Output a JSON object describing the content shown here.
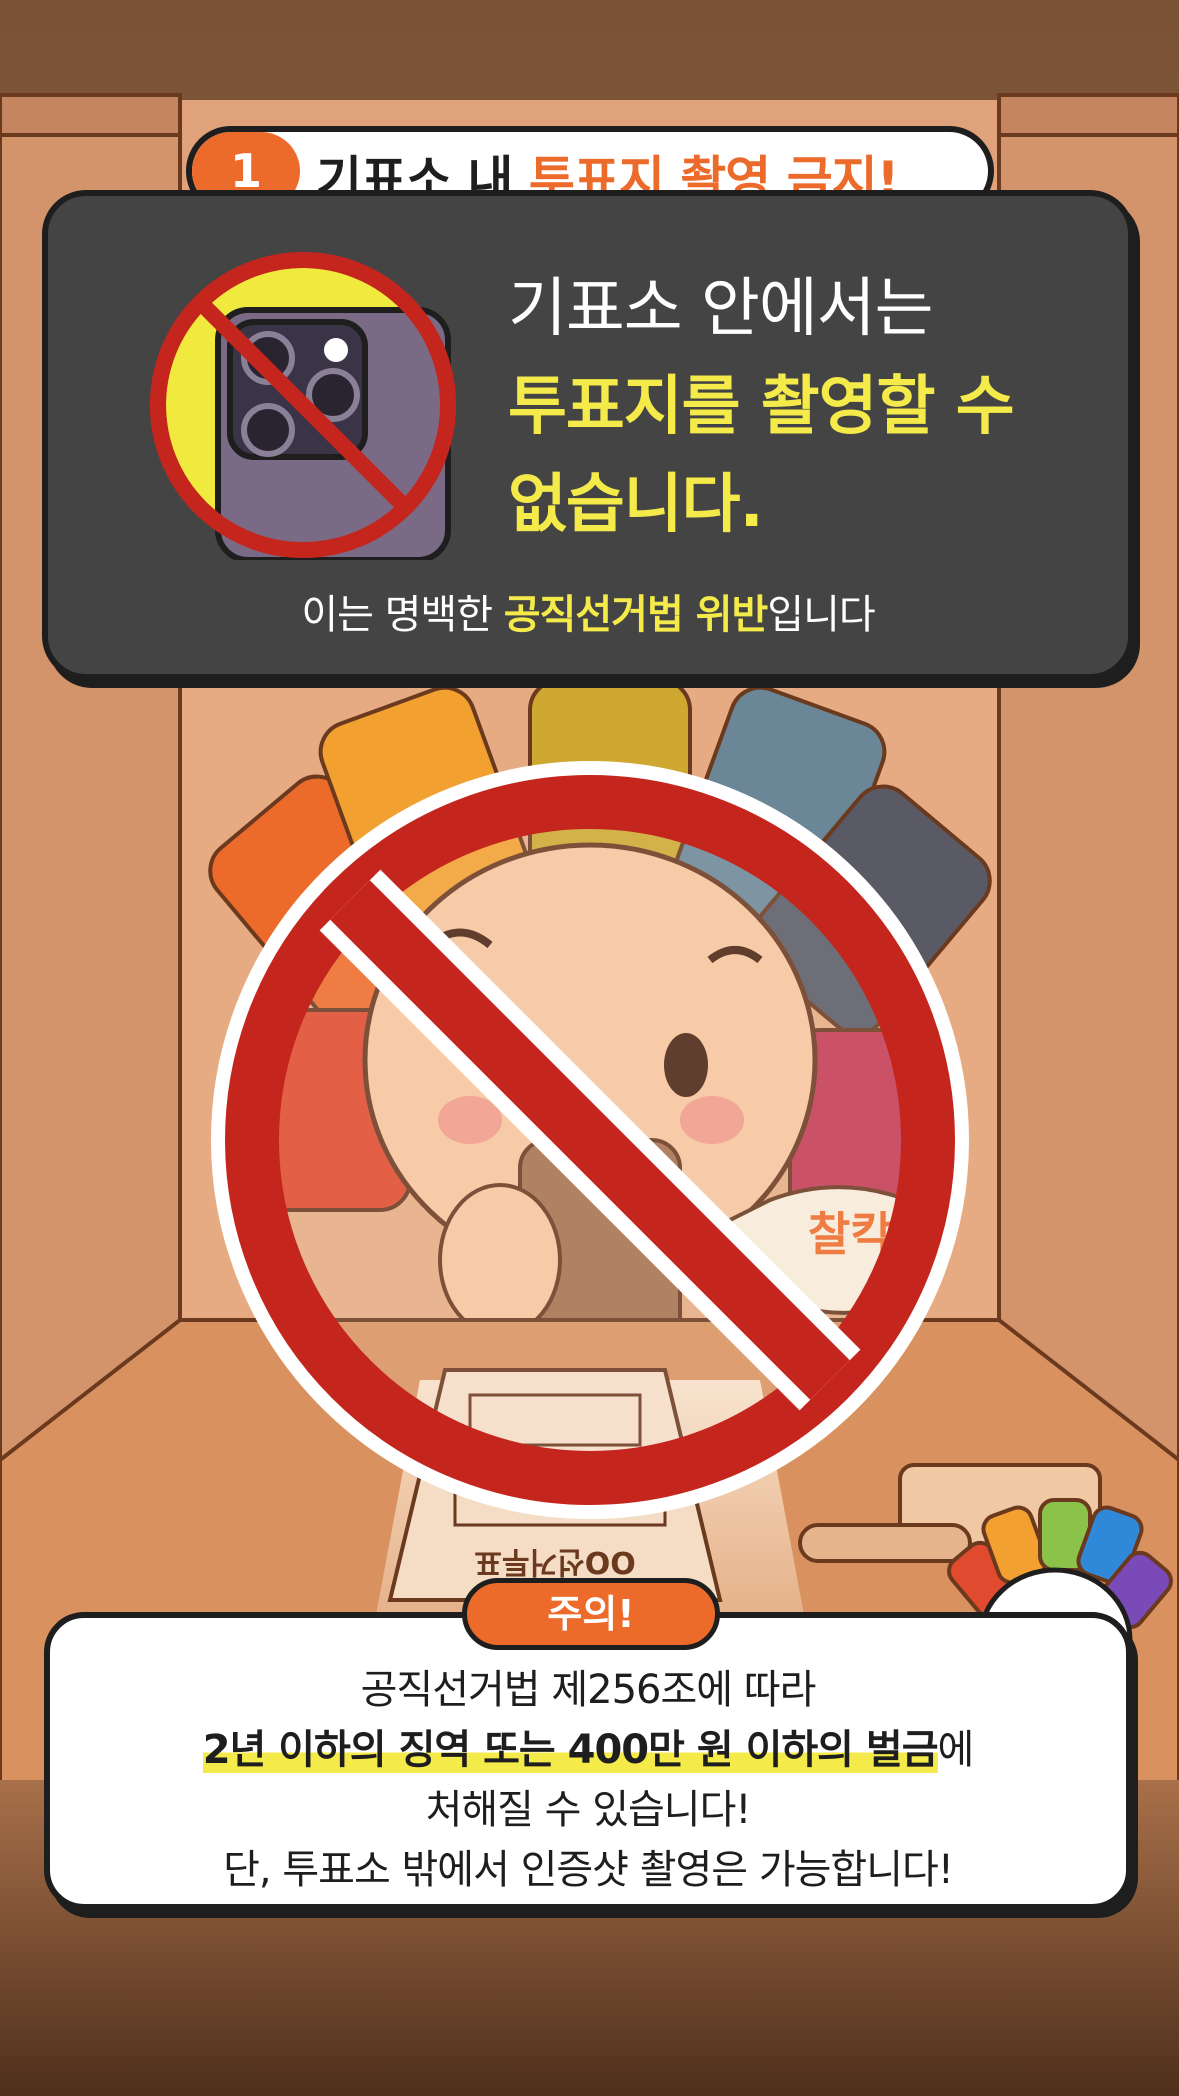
{
  "title_tag": {
    "number": "1",
    "text_before": "기표소 내 ",
    "text_highlight": "투표지 촬영 금지!"
  },
  "headline": {
    "line1": "기표소 안에서는",
    "line2_highlight": "투표지를 촬영할 수",
    "line3_highlight": "없습니다."
  },
  "subline": {
    "before": "이는 명백한 ",
    "highlight": "공직선거법 위반",
    "after": "입니다"
  },
  "illustration": {
    "sound_effect": "찰칵",
    "ballot_text": "OO선거투표"
  },
  "notice": {
    "label": "주의!",
    "line1": "공직선거법 제256조에 따라",
    "line2_highlight": "2년 이하의 징역 또는 400만 원 이하의 벌금",
    "line2_after": "에",
    "line3": "처해질 수 있습니다!",
    "line4": "단, 투표소 밖에서 인증샷 촬영은 가능합니다!"
  },
  "colors": {
    "accent_orange": "#ec6a2a",
    "highlight_yellow": "#f4ea4a",
    "panel_dark": "#444444",
    "prohibition_red": "#c4261e"
  },
  "icons": [
    "no-camera-icon",
    "prohibition-sign-icon"
  ]
}
